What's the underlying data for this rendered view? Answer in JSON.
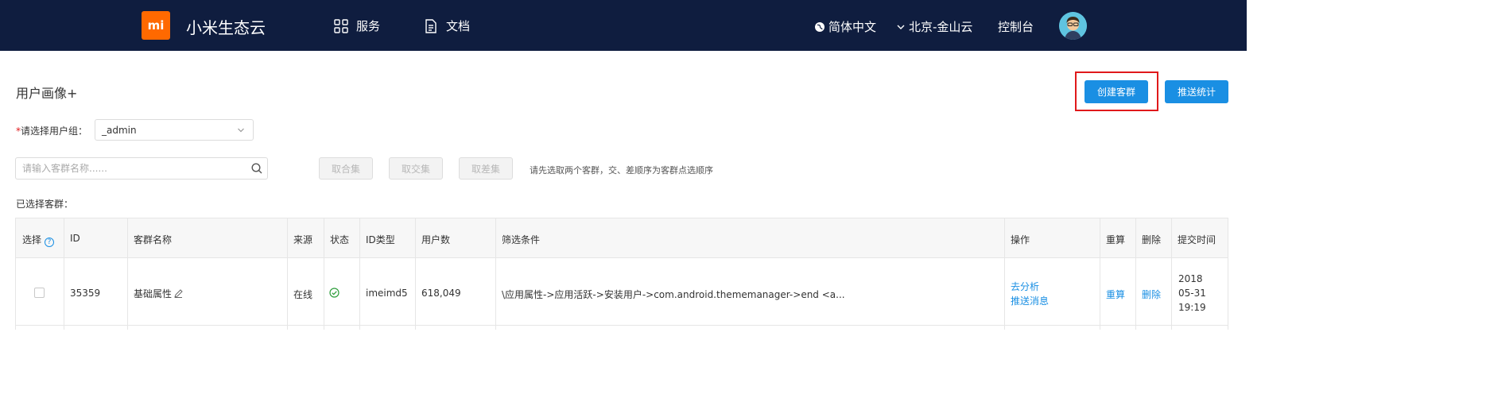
{
  "header": {
    "logo_text": "mi",
    "brand": "小米生态云",
    "nav": [
      {
        "label": "服务",
        "icon": "grid-icon"
      },
      {
        "label": "文档",
        "icon": "document-icon"
      }
    ],
    "language": "简体中文",
    "region": "北京-金山云",
    "console": "控制台"
  },
  "page": {
    "title": "用户画像+",
    "create_button": "创建客群",
    "push_stats_button": "推送统计",
    "user_group_label": "请选择用户组：",
    "user_group_required": "*",
    "user_group_value": "_admin",
    "search_placeholder": "请输入客群名称......",
    "union_button": "取合集",
    "intersect_button": "取交集",
    "difference_button": "取差集",
    "hint": "请先选取两个客群，交、差顺序为客群点选顺序",
    "selected_label": "已选择客群："
  },
  "table": {
    "columns": [
      "选择",
      "ID",
      "客群名称",
      "来源",
      "状态",
      "ID类型",
      "用户数",
      "筛选条件",
      "操作",
      "重算",
      "删除",
      "提交时间"
    ],
    "rows": [
      {
        "id": "35359",
        "name": "基础属性",
        "source": "在线",
        "id_type": "imeimd5",
        "users": "618,049",
        "filter": "\\应用属性->应用活跃->安装用户->com.android.thememanager->end <a...",
        "action_analyze": "去分析",
        "action_push": "推送消息",
        "recalc": "重算",
        "delete": "删除",
        "time_year": "2018",
        "time_date": "05-31",
        "time_clock": "19:19"
      }
    ]
  },
  "colors": {
    "header_bg": "#0f1d3f",
    "logo": "#ff6900",
    "primary": "#1a8fe3",
    "highlight": "#e0191b"
  }
}
